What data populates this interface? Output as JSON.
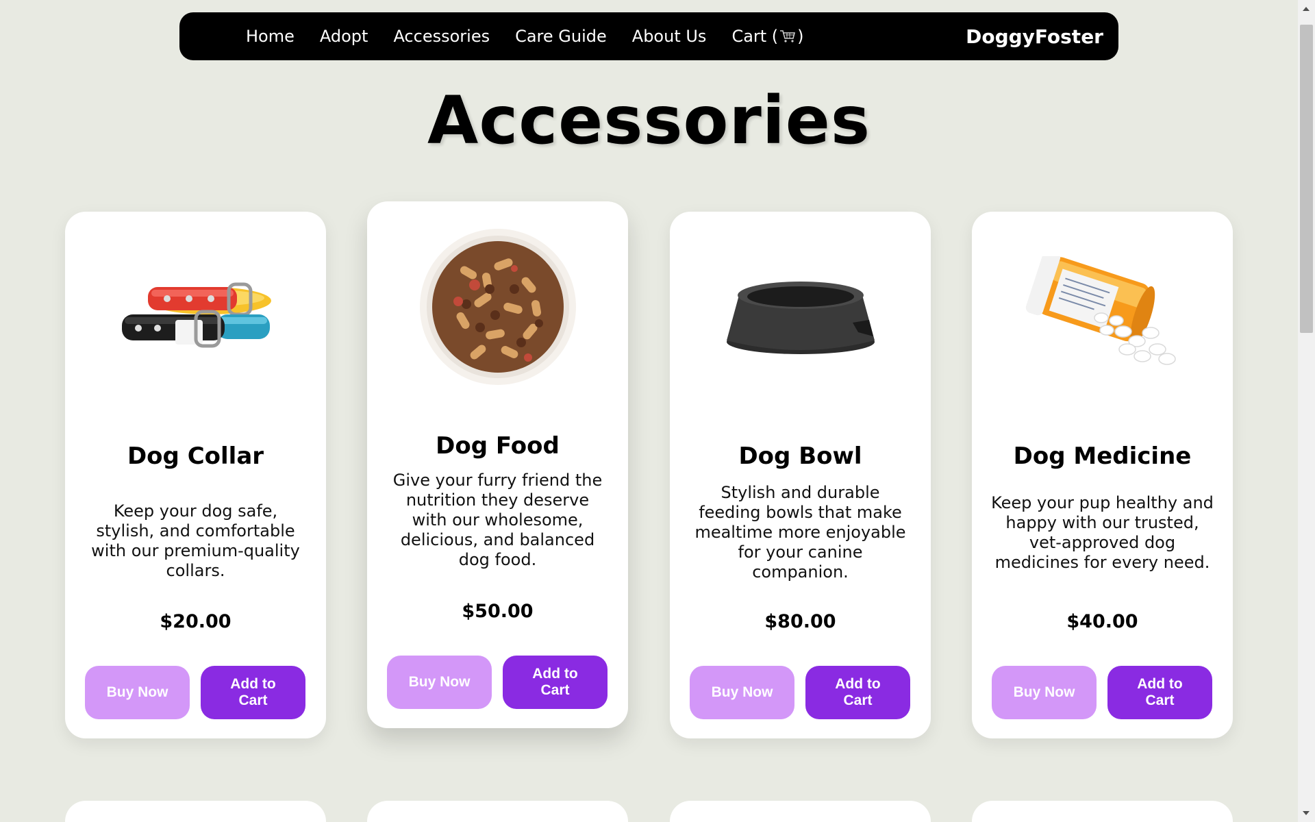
{
  "nav": {
    "links": [
      "Home",
      "Adopt",
      "Accessories",
      "Care Guide",
      "About Us"
    ],
    "cart_prefix": "Cart (",
    "cart_suffix": ")",
    "cart_icon": "shopping-cart-icon",
    "brand": "DoggyFoster"
  },
  "page": {
    "title": "Accessories"
  },
  "products": [
    {
      "title": "Dog Collar",
      "description": "Keep your dog safe, stylish, and comfortable with our premium-quality collars.",
      "price": "$20.00",
      "buy_label": "Buy Now",
      "cart_label": "Add to Cart",
      "image_icon": "dog-collar-image"
    },
    {
      "title": "Dog Food",
      "description": "Give your furry friend the nutrition they deserve with our wholesome, delicious, and balanced dog food.",
      "price": "$50.00",
      "buy_label": "Buy Now",
      "cart_label": "Add to Cart",
      "image_icon": "dog-food-bowl-image"
    },
    {
      "title": "Dog Bowl",
      "description": "Stylish and durable feeding bowls that make mealtime more enjoyable for your canine companion.",
      "price": "$80.00",
      "buy_label": "Buy Now",
      "cart_label": "Add to Cart",
      "image_icon": "dog-bowl-image"
    },
    {
      "title": "Dog Medicine",
      "description": "Keep your pup healthy and happy with our trusted, vet-approved dog medicines for every need.",
      "price": "$40.00",
      "buy_label": "Buy Now",
      "cart_label": "Add to Cart",
      "image_icon": "pill-bottle-image"
    }
  ],
  "colors": {
    "background": "#e8eae2",
    "nav_bg": "#000000",
    "buy_button": "#d397f8",
    "cart_button": "#8a2be2",
    "card_bg": "#ffffff"
  }
}
